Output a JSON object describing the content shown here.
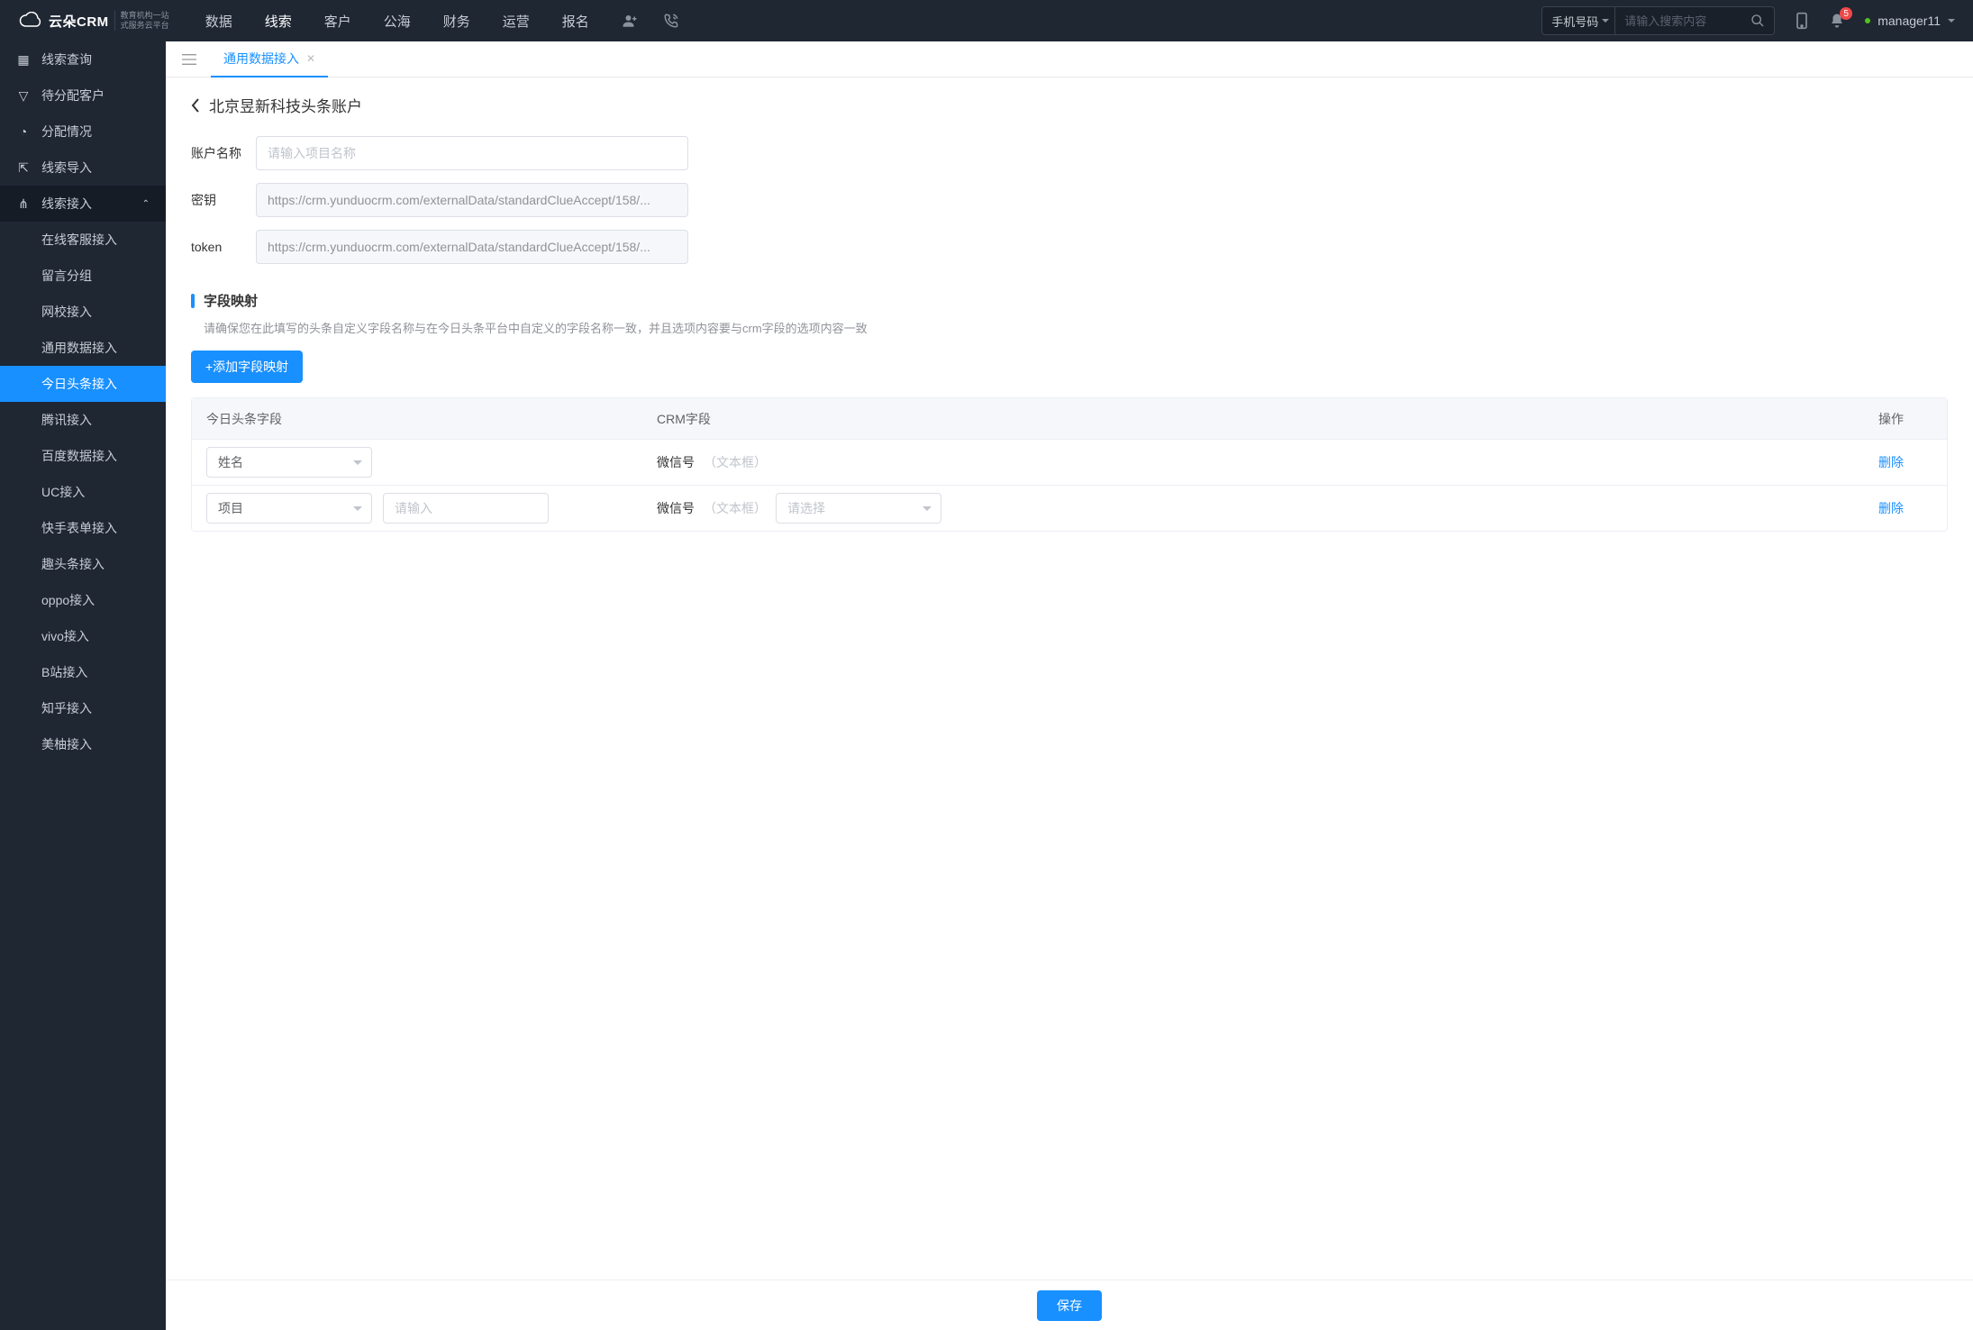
{
  "header": {
    "logo_text": "云朵CRM",
    "logo_sub1": "教育机构一站",
    "logo_sub2": "式服务云平台",
    "nav": [
      "数据",
      "线索",
      "客户",
      "公海",
      "财务",
      "运营",
      "报名"
    ],
    "nav_active": 1,
    "search_select": "手机号码",
    "search_placeholder": "请输入搜索内容",
    "notification_count": "5",
    "username": "manager11"
  },
  "sidebar": {
    "items": [
      {
        "label": "线索查询"
      },
      {
        "label": "待分配客户"
      },
      {
        "label": "分配情况"
      },
      {
        "label": "线索导入"
      },
      {
        "label": "线索接入",
        "expanded": true,
        "children": [
          "在线客服接入",
          "留言分组",
          "网校接入",
          "通用数据接入",
          "今日头条接入",
          "腾讯接入",
          "百度数据接入",
          "UC接入",
          "快手表单接入",
          "趣头条接入",
          "oppo接入",
          "vivo接入",
          "B站接入",
          "知乎接入",
          "美柚接入"
        ],
        "active_child": 4
      }
    ]
  },
  "tabs": {
    "active": "通用数据接入"
  },
  "page": {
    "title": "北京昱新科技头条账户",
    "form": {
      "account_label": "账户名称",
      "account_placeholder": "请输入项目名称",
      "secret_label": "密钥",
      "secret_value": "https://crm.yunduocrm.com/externalData/standardClueAccept/158/...",
      "token_label": "token",
      "token_value": "https://crm.yunduocrm.com/externalData/standardClueAccept/158/..."
    },
    "section": {
      "title": "字段映射",
      "desc": "请确保您在此填写的头条自定义字段名称与在今日头条平台中自定义的字段名称一致，并且选项内容要与crm字段的选项内容一致",
      "add_button": "+添加字段映射"
    },
    "table": {
      "h1": "今日头条字段",
      "h2": "CRM字段",
      "h3": "操作",
      "rows": [
        {
          "field": "姓名",
          "crm_name": "微信号",
          "crm_type": "（文本框）",
          "has_input": false,
          "has_select": false
        },
        {
          "field": "项目",
          "input_placeholder": "请输入",
          "crm_name": "微信号",
          "crm_type": "（文本框）",
          "select_placeholder": "请选择",
          "has_input": true,
          "has_select": true
        }
      ],
      "delete_label": "删除"
    },
    "save": "保存"
  }
}
